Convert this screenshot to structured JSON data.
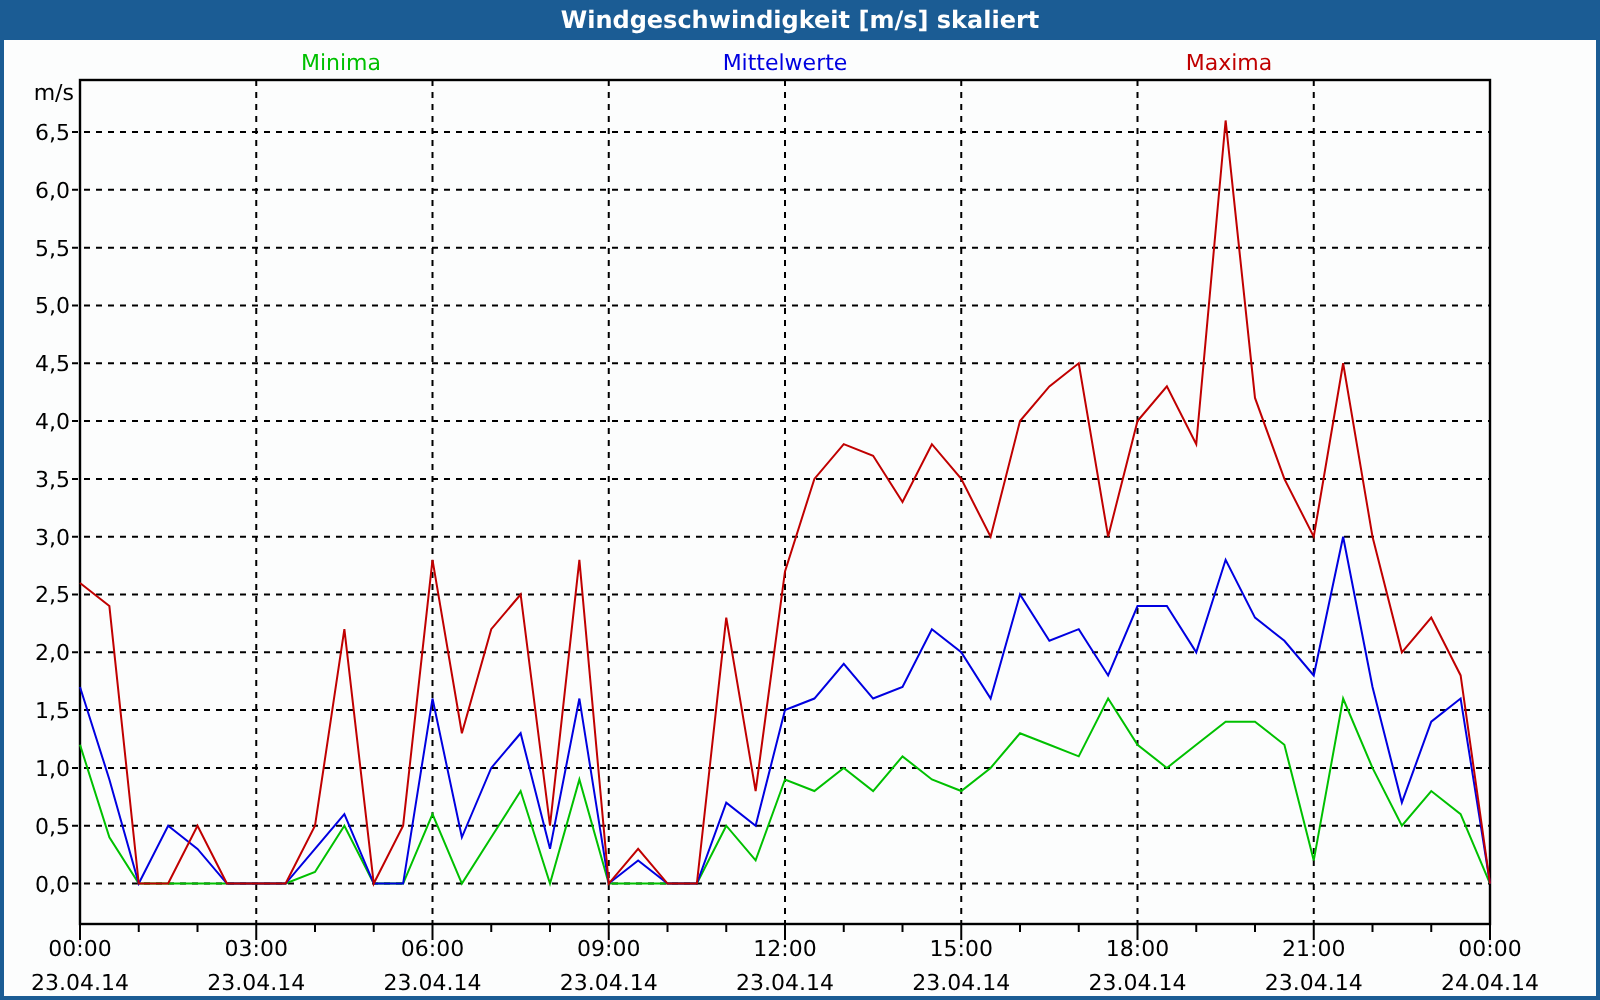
{
  "window": {
    "title": "Windgeschwindigkeit [m/s] skaliert"
  },
  "chart": {
    "chart_data": {
      "type": "line",
      "grid": true,
      "ylabel": "m/s",
      "ylim": [
        -0.35,
        6.95
      ],
      "categories": [
        "00:00 23.04.14",
        null,
        null,
        null,
        null,
        null,
        "03:00 23.04.14",
        null,
        null,
        null,
        null,
        null,
        "06:00 23.04.14",
        null,
        null,
        null,
        null,
        null,
        "09:00 23.04.14",
        null,
        null,
        null,
        null,
        null,
        "12:00 23.04.14",
        null,
        null,
        null,
        null,
        null,
        "15:00 23.04.14",
        null,
        null,
        null,
        null,
        null,
        "18:00 23.04.14",
        null,
        null,
        null,
        null,
        null,
        "21:00 23.04.14",
        null,
        null,
        null,
        null,
        null,
        "00:00 24.04.14"
      ],
      "yticks": [
        {
          "value": 0,
          "label": "0,0"
        },
        {
          "value": 0.5,
          "label": "0,5"
        },
        {
          "value": 1,
          "label": "1,0"
        },
        {
          "value": 1.5,
          "label": "1,5"
        },
        {
          "value": 2,
          "label": "2,0"
        },
        {
          "value": 2.5,
          "label": "2,5"
        },
        {
          "value": 3,
          "label": "3,0"
        },
        {
          "value": 3.5,
          "label": "3,5"
        },
        {
          "value": 4,
          "label": "4,0"
        },
        {
          "value": 4.5,
          "label": "4,5"
        },
        {
          "value": 5,
          "label": "5,0"
        },
        {
          "value": 5.5,
          "label": "5,5"
        },
        {
          "value": 6,
          "label": "6,0"
        },
        {
          "value": 6.5,
          "label": "6,5"
        }
      ],
      "series": [
        {
          "name": "Minima",
          "color": "#00c000",
          "values": [
            1.2,
            0.4,
            0,
            0,
            0,
            0,
            0,
            0,
            0.1,
            0.5,
            0,
            0,
            0.6,
            0,
            0.4,
            0.8,
            0,
            0.9,
            0,
            0,
            0,
            0,
            0.5,
            0.2,
            0.9,
            0.8,
            1.0,
            0.8,
            1.1,
            0.9,
            0.8,
            1.0,
            1.3,
            1.2,
            1.1,
            1.6,
            1.2,
            1.0,
            1.2,
            1.4,
            1.4,
            1.2,
            0.2,
            1.6,
            1.0,
            0.5,
            0.8,
            0.6,
            0
          ]
        },
        {
          "name": "Mittelwerte",
          "color": "#0000e0",
          "values": [
            1.7,
            0.9,
            0,
            0.5,
            0.3,
            0,
            0,
            0,
            0.3,
            0.6,
            0,
            0,
            1.6,
            0.4,
            1.0,
            1.3,
            0.3,
            1.6,
            0,
            0.2,
            0,
            0,
            0.7,
            0.5,
            1.5,
            1.6,
            1.9,
            1.6,
            1.7,
            2.2,
            2.0,
            1.6,
            2.5,
            2.1,
            2.2,
            1.8,
            2.4,
            2.4,
            2.0,
            2.8,
            2.3,
            2.1,
            1.8,
            3.0,
            1.7,
            0.7,
            1.4,
            1.6,
            0
          ]
        },
        {
          "name": "Maxima",
          "color": "#c00000",
          "values": [
            2.6,
            2.4,
            0,
            0,
            0.5,
            0,
            0,
            0,
            0.5,
            2.2,
            0,
            0.5,
            2.8,
            1.3,
            2.2,
            2.5,
            0.5,
            2.8,
            0,
            0.3,
            0,
            0,
            2.3,
            0.8,
            2.7,
            3.5,
            3.8,
            3.7,
            3.3,
            3.8,
            3.5,
            3.0,
            4.0,
            4.3,
            4.5,
            3.0,
            4.0,
            4.3,
            3.8,
            6.6,
            4.2,
            3.5,
            3.0,
            4.5,
            3.0,
            2.0,
            2.3,
            1.8,
            0
          ]
        }
      ]
    }
  }
}
